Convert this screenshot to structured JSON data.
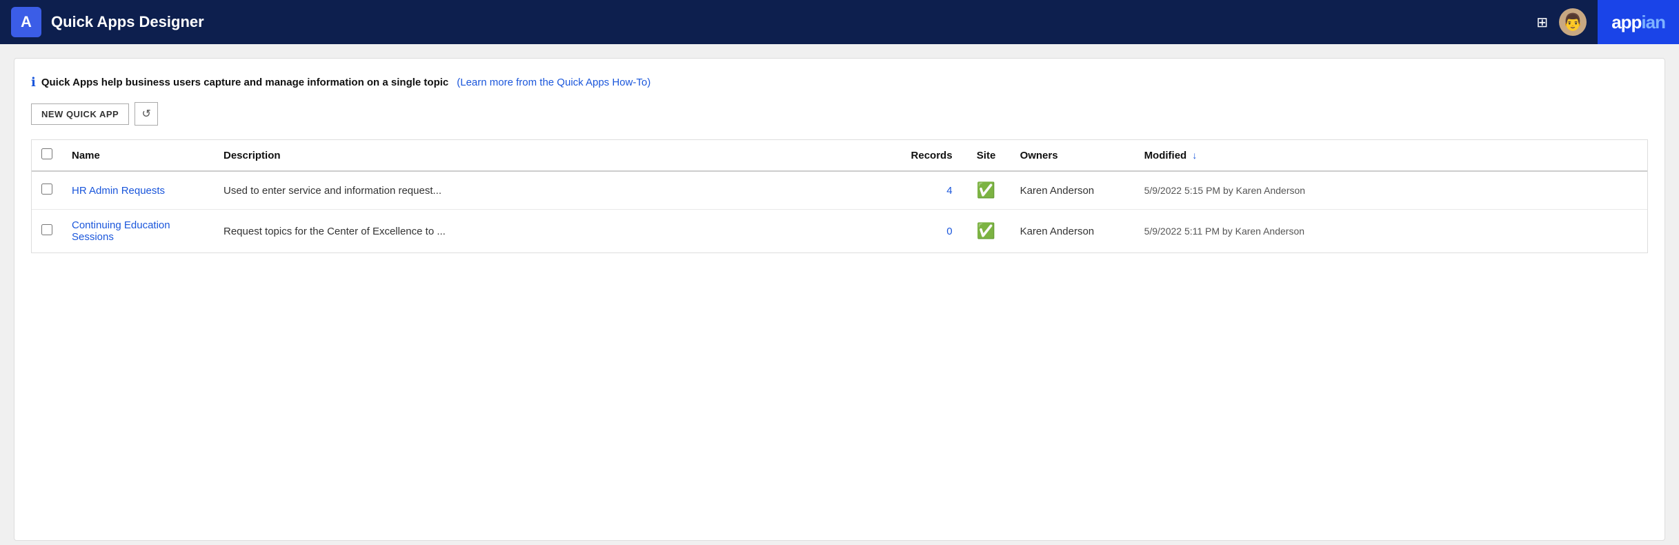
{
  "header": {
    "logo_symbol": "A",
    "title": "Quick Apps Designer",
    "grid_icon": "⊞",
    "avatar_emoji": "👨",
    "appian_label": "app",
    "appian_label_accent": "ian"
  },
  "info": {
    "text": "Quick Apps help business users capture and manage information on a single topic",
    "link_text": "(Learn more from the Quick Apps How-To)"
  },
  "toolbar": {
    "new_label": "NEW QUICK APP",
    "refresh_icon": "↺"
  },
  "table": {
    "columns": [
      {
        "key": "checkbox",
        "label": ""
      },
      {
        "key": "name",
        "label": "Name"
      },
      {
        "key": "description",
        "label": "Description"
      },
      {
        "key": "records",
        "label": "Records"
      },
      {
        "key": "site",
        "label": "Site"
      },
      {
        "key": "owners",
        "label": "Owners"
      },
      {
        "key": "modified",
        "label": "Modified"
      }
    ],
    "rows": [
      {
        "name": "HR Admin Requests",
        "description": "Used to enter service and information request...",
        "records": "4",
        "site_active": true,
        "owners": "Karen Anderson",
        "modified": "5/9/2022 5:15 PM by Karen Anderson"
      },
      {
        "name": "Continuing Education Sessions",
        "description": "Request topics for the Center of Excellence to ...",
        "records": "0",
        "site_active": true,
        "owners": "Karen Anderson",
        "modified": "5/9/2022 5:11 PM by Karen Anderson"
      }
    ]
  },
  "colors": {
    "header_bg": "#0d1f4e",
    "appian_blue": "#1a44e8",
    "link_blue": "#1a56db",
    "green": "#2ea44f"
  }
}
